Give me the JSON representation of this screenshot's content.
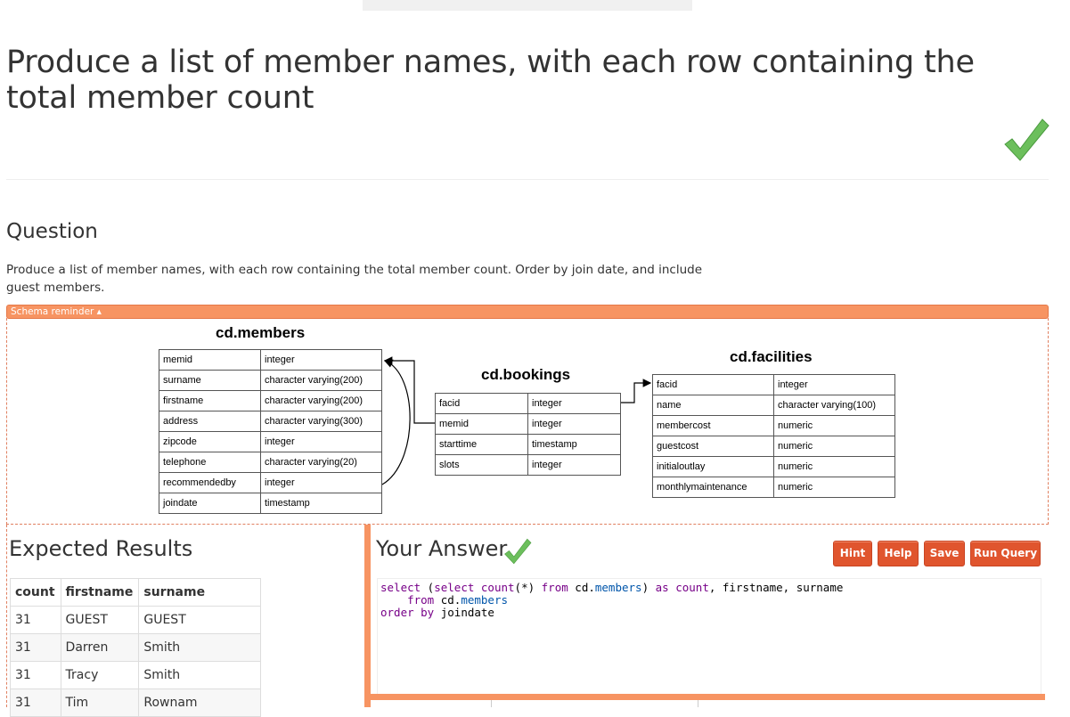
{
  "page": {
    "title": "Produce a list of member names, with each row containing the total member count"
  },
  "question": {
    "heading": "Question",
    "text": "Produce a list of member names, with each row containing the total member count. Order by join date, and include guest members."
  },
  "schema": {
    "toggle_label": "Schema reminder ▴",
    "tables": [
      {
        "name": "cd.members",
        "columns": [
          [
            "memid",
            "integer"
          ],
          [
            "surname",
            "character varying(200)"
          ],
          [
            "firstname",
            "character varying(200)"
          ],
          [
            "address",
            "character varying(300)"
          ],
          [
            "zipcode",
            "integer"
          ],
          [
            "telephone",
            "character varying(20)"
          ],
          [
            "recommendedby",
            "integer"
          ],
          [
            "joindate",
            "timestamp"
          ]
        ]
      },
      {
        "name": "cd.bookings",
        "columns": [
          [
            "facid",
            "integer"
          ],
          [
            "memid",
            "integer"
          ],
          [
            "starttime",
            "timestamp"
          ],
          [
            "slots",
            "integer"
          ]
        ]
      },
      {
        "name": "cd.facilities",
        "columns": [
          [
            "facid",
            "integer"
          ],
          [
            "name",
            "character varying(100)"
          ],
          [
            "membercost",
            "numeric"
          ],
          [
            "guestcost",
            "numeric"
          ],
          [
            "initialoutlay",
            "numeric"
          ],
          [
            "monthlymaintenance",
            "numeric"
          ]
        ]
      }
    ]
  },
  "expected": {
    "heading": "Expected Results",
    "headers": [
      "count",
      "firstname",
      "surname"
    ],
    "rows": [
      [
        "31",
        "GUEST",
        "GUEST"
      ],
      [
        "31",
        "Darren",
        "Smith"
      ],
      [
        "31",
        "Tracy",
        "Smith"
      ],
      [
        "31",
        "Tim",
        "Rownam"
      ]
    ]
  },
  "answer": {
    "heading": "Your Answer",
    "buttons": {
      "hint": "Hint",
      "help": "Help",
      "save": "Save",
      "run": "Run Query"
    },
    "code_lines": [
      "select (select count(*) from cd.members) as count, firstname, surname",
      "    from cd.members",
      "order by joindate"
    ]
  },
  "colors": {
    "accent": "#f79462",
    "button": "#e0552e",
    "check": "#6cbf5c"
  }
}
